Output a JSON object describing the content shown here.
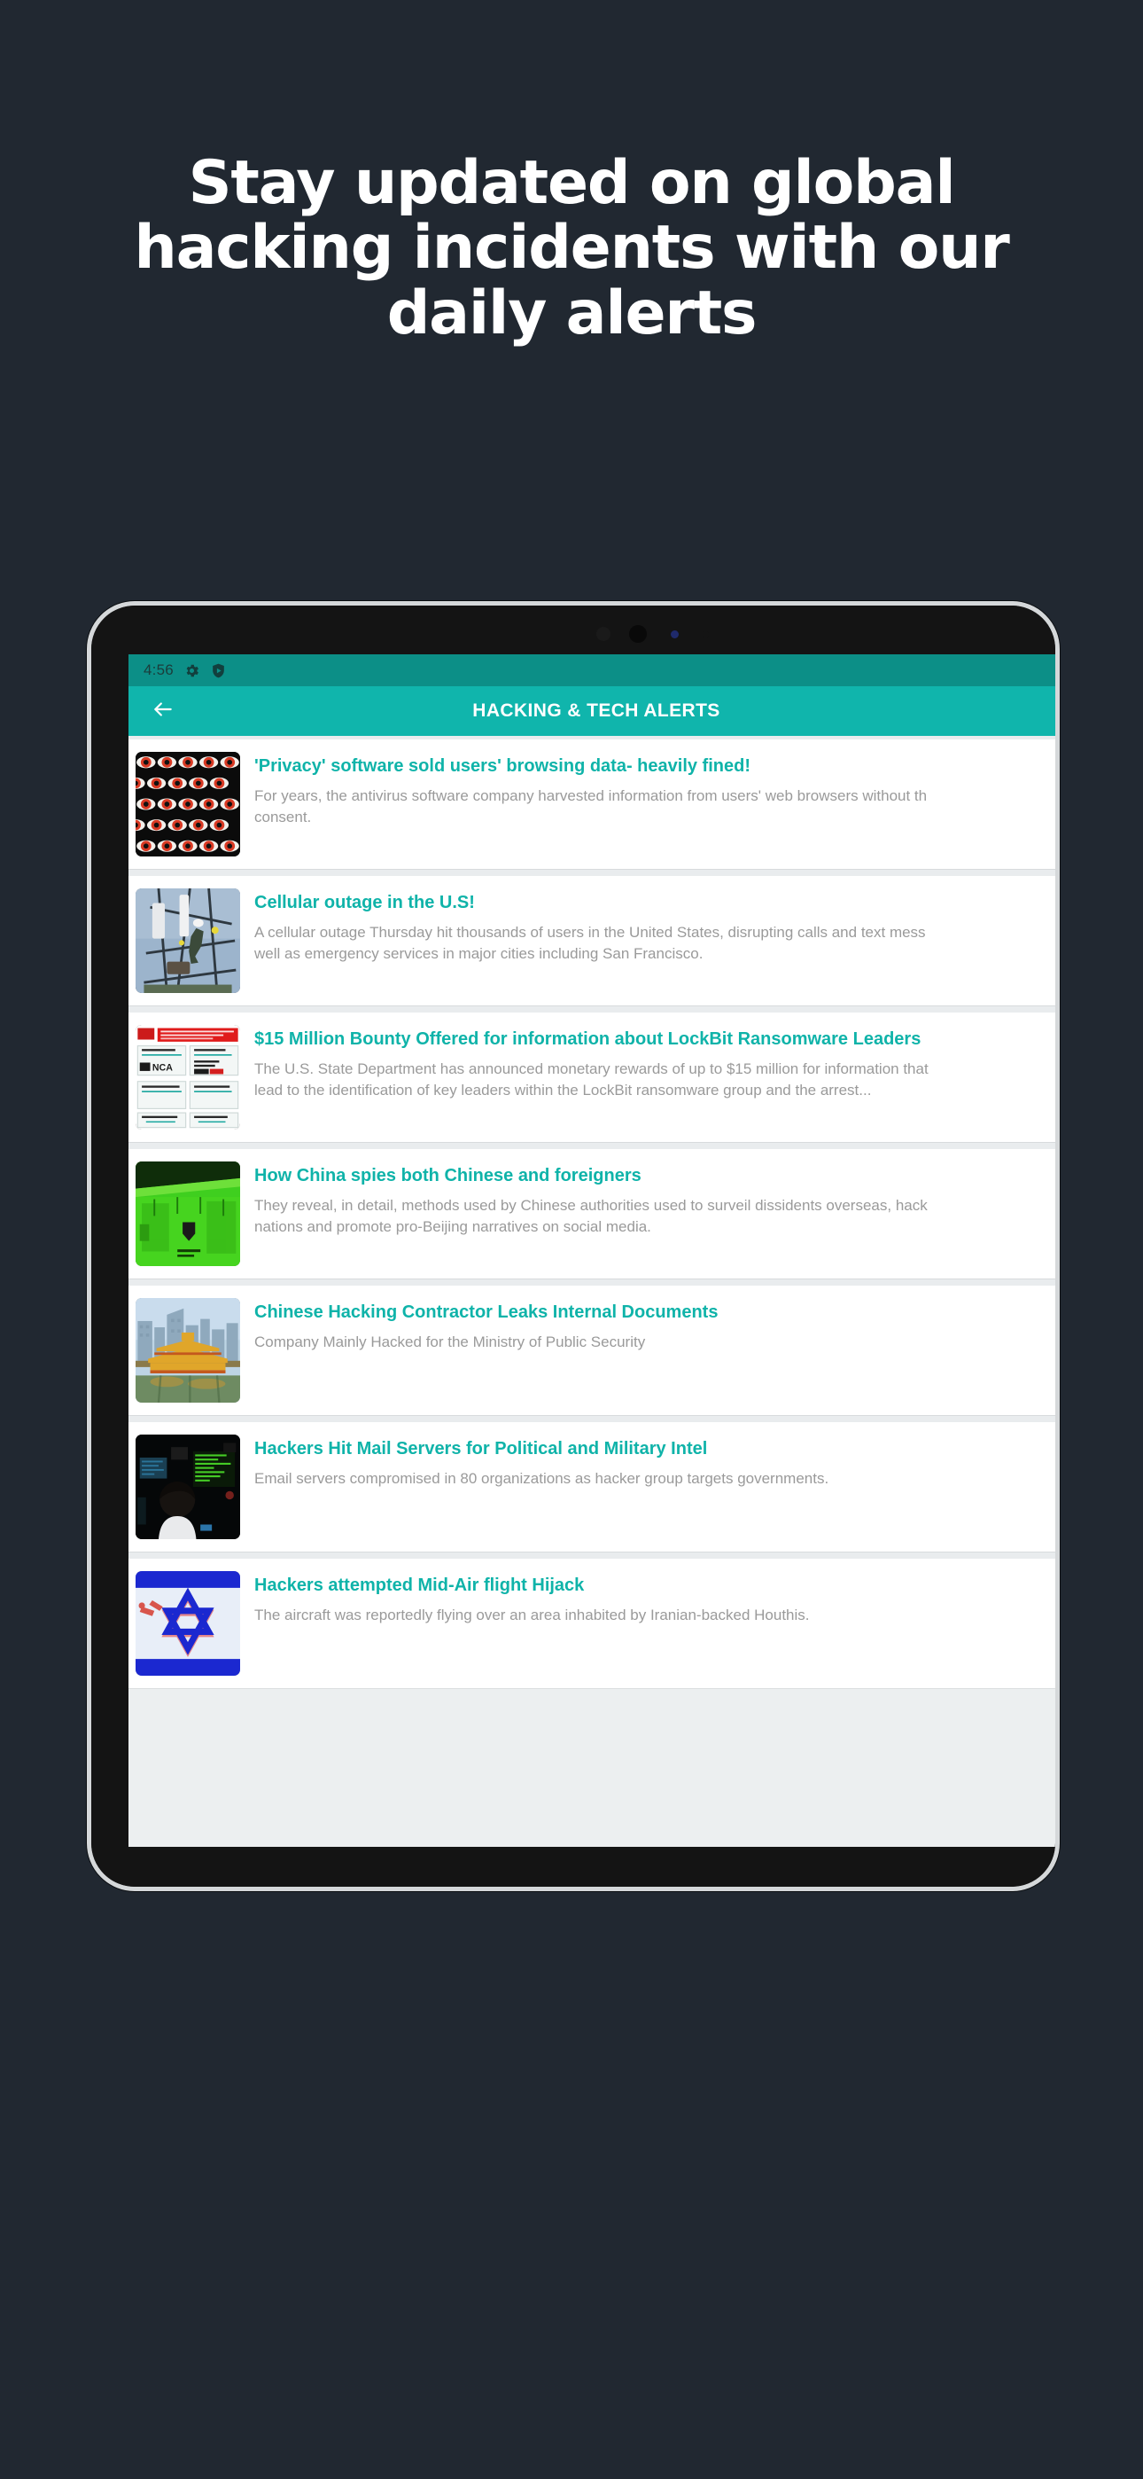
{
  "headline": {
    "lines": [
      "Stay updated on global",
      "hacking incidents with our",
      "daily alerts"
    ]
  },
  "colors": {
    "background": "#212831",
    "accent_teal": "#10b5ac",
    "statusbar_teal": "#0c8f87",
    "title_teal": "#0fb3a9",
    "desc_gray": "#9a9a9a",
    "card_white": "#ffffff",
    "list_gray": "#e9ecee",
    "headline_white": "#ffffff",
    "frame_silver": "#d5d8da"
  },
  "device": {
    "statusbar": {
      "time": "4:56",
      "icons": [
        "gear-icon",
        "shield-play-icon"
      ]
    },
    "appbar": {
      "back_icon": "arrow-left-icon",
      "title": "HACKING & TECH ALERTS"
    }
  },
  "news": {
    "items": [
      {
        "thumbnail": "red-eyes-pattern-image",
        "title": "'Privacy' software sold users' browsing data- heavily fined!",
        "desc_lines": [
          "For years, the antivirus software company harvested information from users' web browsers without th",
          "consent."
        ]
      },
      {
        "thumbnail": "cell-tower-worker-image",
        "title": "Cellular outage in the U.S!",
        "desc_lines": [
          "A cellular outage Thursday hit thousands of users in the United States, disrupting calls and text mess",
          "well as emergency services in major cities including San Francisco."
        ]
      },
      {
        "thumbnail": "lockbit-takedown-notice-image",
        "title": "$15 Million Bounty Offered for information about LockBit Ransomware Leaders",
        "desc_lines": [
          "The U.S. State Department has announced monetary rewards of up to $15 million for information that",
          "lead to the identification of key leaders within the LockBit ransomware group and the arrest..."
        ]
      },
      {
        "thumbnail": "green-server-room-image",
        "title": "How China spies both Chinese and foreigners",
        "desc_lines": [
          "They reveal, in detail, methods used by Chinese authorities used to surveil dissidents overseas, hack",
          "nations and promote pro-Beijing narratives on social media."
        ]
      },
      {
        "thumbnail": "chinese-city-bridge-image",
        "title": "Chinese Hacking Contractor Leaks Internal Documents",
        "desc_lines": [
          "Company Mainly Hacked for the Ministry of Public Security"
        ]
      },
      {
        "thumbnail": "hacker-at-computer-image",
        "title": "Hackers Hit Mail Servers for Political and Military Intel",
        "desc_lines": [
          "Email servers compromised in 80 organizations as hacker group targets governments."
        ]
      },
      {
        "thumbnail": "israel-flag-image",
        "title": "Hackers attempted Mid-Air flight Hijack",
        "desc_lines": [
          "The aircraft was reportedly flying over an area inhabited by Iranian-backed Houthis."
        ]
      }
    ]
  }
}
